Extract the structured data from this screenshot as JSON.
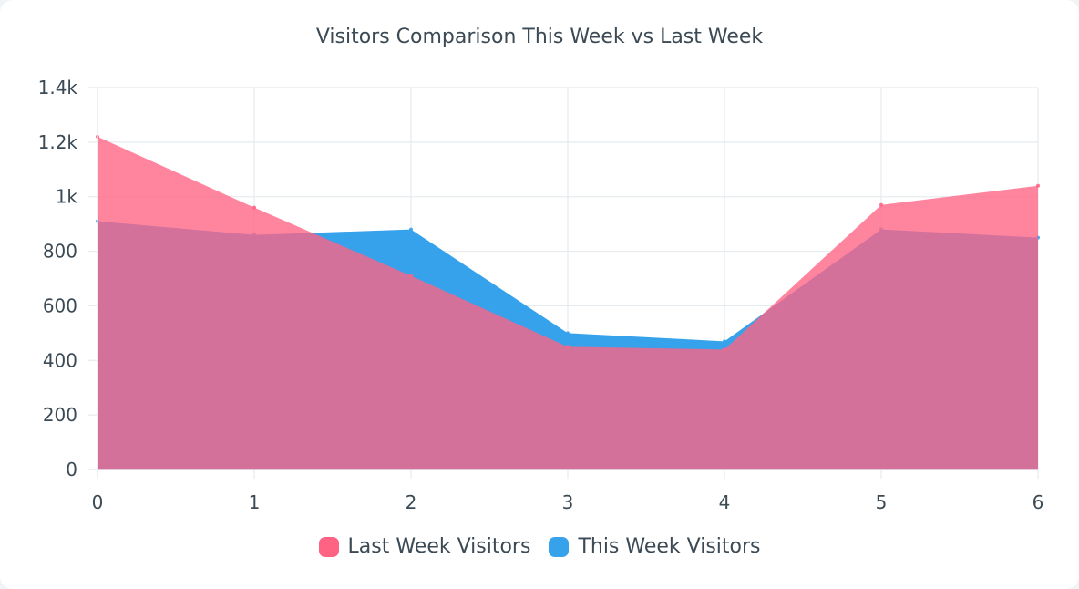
{
  "chart_data": {
    "type": "area",
    "title": "Visitors Comparison This Week vs Last Week",
    "x": [
      0,
      1,
      2,
      3,
      4,
      5,
      6
    ],
    "ylim": [
      0,
      1400
    ],
    "yticks": [
      0,
      200,
      400,
      600,
      800,
      1000,
      1200,
      1400
    ],
    "yticklabels": [
      "0",
      "200",
      "400",
      "600",
      "800",
      "1k",
      "1.2k",
      "1.4k"
    ],
    "grid": true,
    "legend_position": "bottom",
    "series": [
      {
        "name": "Last Week Visitors",
        "color": "#ff6384",
        "values": [
          1220,
          960,
          710,
          450,
          440,
          970,
          1040
        ]
      },
      {
        "name": "This Week Visitors",
        "color": "#36a2eb",
        "values": [
          910,
          860,
          880,
          500,
          470,
          880,
          850
        ]
      }
    ]
  }
}
